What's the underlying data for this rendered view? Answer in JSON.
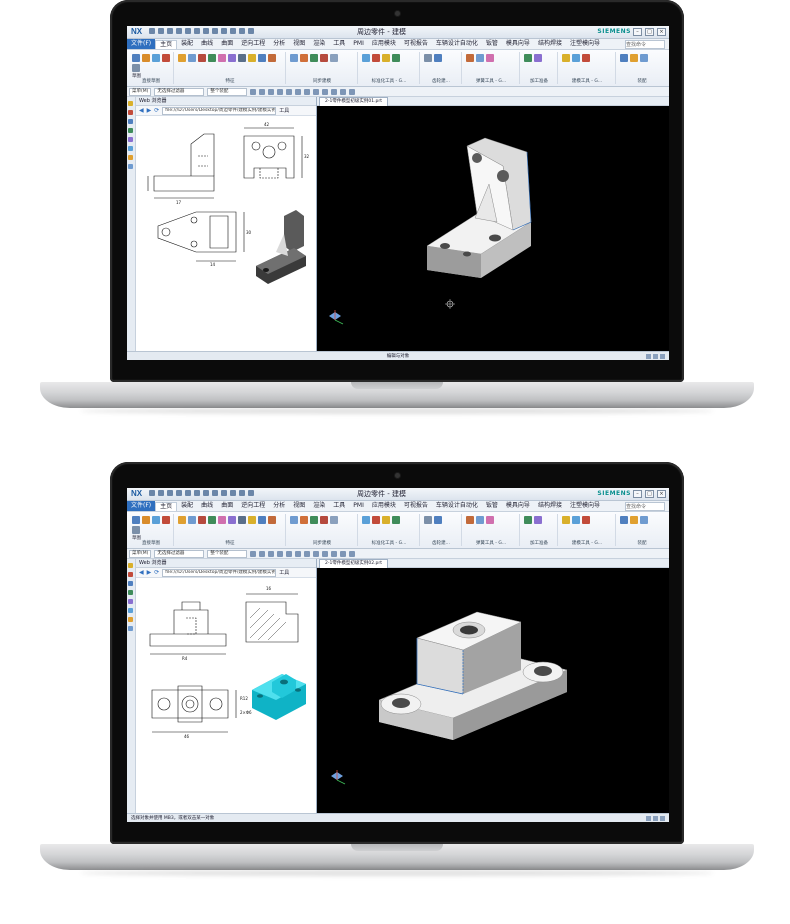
{
  "colors": {
    "accent": "#2f6fbf",
    "viewport_background": "#000000",
    "model_highlight": "#16c7d8"
  },
  "laptops": [
    {
      "app": {
        "logo": "NX",
        "window_title": "周边零件 - 建模",
        "brand": "SIEMENS",
        "menu_file": "文件(F)",
        "menu_tabs": [
          "主页",
          "装配",
          "曲线",
          "曲面",
          "逆向工程",
          "分析",
          "视图",
          "渲染",
          "工具",
          "PMI",
          "应用模块",
          "可视报告",
          "车辆设计自动化",
          "钣管",
          "模具向导",
          "结构焊接",
          "注塑模向导"
        ],
        "active_tab": "主页",
        "search_placeholder": "查找命令",
        "ribbon_groups": [
          "直接草图",
          "特征",
          "同步建模",
          "标准化工具 - G...",
          "齿轮建...",
          "弹簧工具 - G...",
          "加工准备",
          "建模工具 - G...",
          "装配"
        ],
        "ribbon_commands": [
          "草图",
          "拉伸",
          "孔",
          "阵列特征",
          "合并",
          "边倒圆",
          "倒斜角",
          "拔模",
          "替换面",
          "偏置区域",
          "删除面",
          "更多"
        ],
        "selbar_filter": "菜单(M)",
        "selbar_combo1": "无选择过滤器",
        "selbar_combo2": "整个装配",
        "web_panel_title": "Web 浏览器",
        "url": "file:///D:/Users/Desktop/周边零件/建模实例/建模实例01.jpg",
        "url_tool": "工具",
        "graphics_tab": "2-1零件模型初级实例01.prt",
        "status_text": "选择对象并使用 MB3，或者双击某一对象",
        "status_center": "编辑与对象"
      }
    },
    {
      "app": {
        "logo": "NX",
        "window_title": "周边零件 - 建模",
        "brand": "SIEMENS",
        "menu_file": "文件(F)",
        "menu_tabs": [
          "主页",
          "装配",
          "曲线",
          "曲面",
          "逆向工程",
          "分析",
          "视图",
          "渲染",
          "工具",
          "PMI",
          "应用模块",
          "可视报告",
          "车辆设计自动化",
          "钣管",
          "模具向导",
          "结构焊接",
          "注塑模向导"
        ],
        "active_tab": "主页",
        "search_placeholder": "查找命令",
        "ribbon_groups": [
          "直接草图",
          "特征",
          "同步建模",
          "标准化工具 - G...",
          "齿轮建...",
          "弹簧工具 - G...",
          "加工准备",
          "建模工具 - G...",
          "装配"
        ],
        "ribbon_commands": [
          "草图",
          "拉伸",
          "孔",
          "阵列特征",
          "合并",
          "边倒圆",
          "倒斜角",
          "拔模",
          "替换面",
          "偏置区域",
          "删除面",
          "更多"
        ],
        "selbar_filter": "菜单(M)",
        "selbar_combo1": "无选择过滤器",
        "selbar_combo2": "整个装配",
        "web_panel_title": "Web 浏览器",
        "url": "file:///D:/Users/Desktop/周边零件/建模实例/建模实例02.jpg",
        "url_tool": "工具",
        "graphics_tab": "2-1零件模型初级实例02.prt",
        "status_text": "选择对象并使用 MB3，或者双击某一对象",
        "status_center": ""
      }
    }
  ]
}
